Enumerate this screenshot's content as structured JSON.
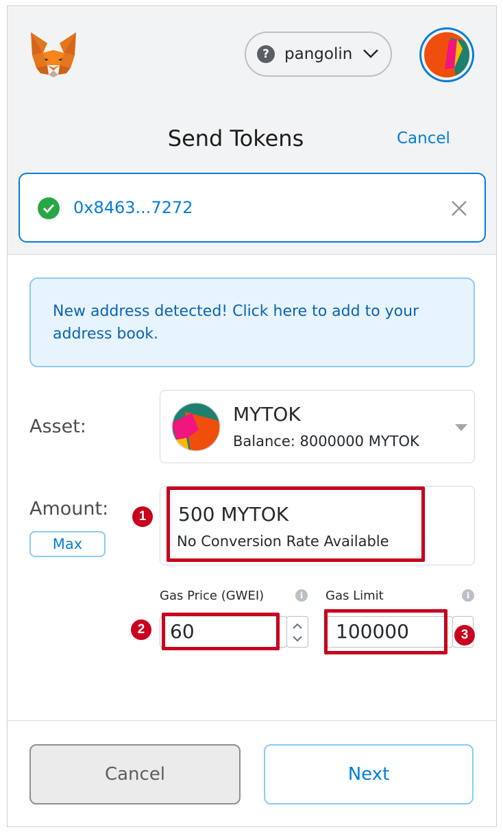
{
  "header": {
    "network": {
      "icon": "question-circle-icon",
      "name": "pangolin",
      "chevron": "chevron-down-icon"
    },
    "logo": "metamask-fox-icon",
    "account_avatar": "account-identicon"
  },
  "send": {
    "title": "Send Tokens",
    "cancel_label": "Cancel"
  },
  "recipient": {
    "status_icon": "check-circle-icon",
    "address": "0x8463...7272",
    "clear_icon": "close-icon"
  },
  "notice": {
    "text": "New address detected! Click here to add to your address book."
  },
  "asset": {
    "label": "Asset:",
    "token_symbol": "MYTOK",
    "balance": "Balance: 8000000 MYTOK"
  },
  "amount": {
    "label": "Amount:",
    "max_label": "Max",
    "value": "500  MYTOK",
    "conversion": "No Conversion Rate Available"
  },
  "gas": {
    "price_label": "Gas Price (GWEI)",
    "price_value": "60",
    "limit_label": "Gas Limit",
    "limit_value": "100000",
    "info_icon": "info-icon"
  },
  "annotations": {
    "badge_1": "1",
    "badge_2": "2",
    "badge_3": "3",
    "highlight_color": "#c8001e"
  },
  "footer": {
    "cancel_label": "Cancel",
    "next_label": "Next"
  },
  "colors": {
    "accent": "#037dd6",
    "success": "#28a745",
    "header_bg": "#f2f3f4",
    "notice_bg": "#e8f4fd"
  }
}
